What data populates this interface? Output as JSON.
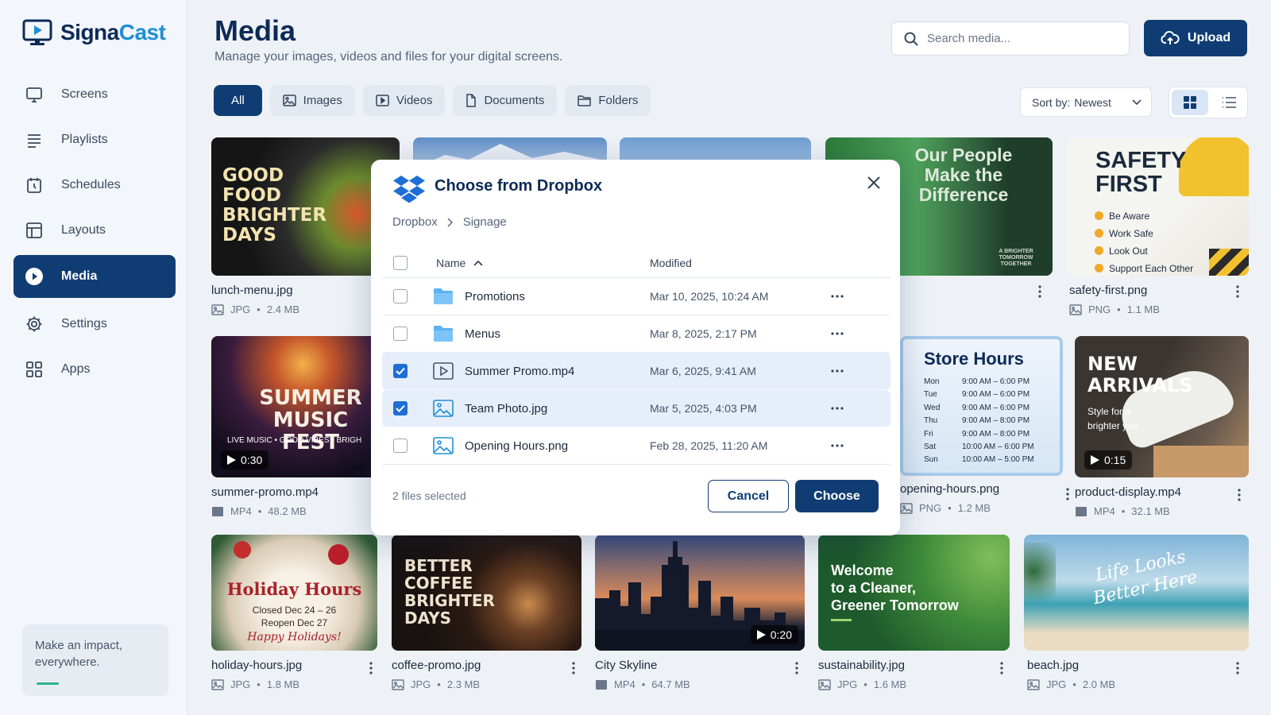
{
  "app": {
    "name_part1": "Signa",
    "name_part2": "Cast"
  },
  "sidebar": {
    "items": [
      {
        "label": "Screens",
        "icon": "monitor-icon"
      },
      {
        "label": "Playlists",
        "icon": "list-icon"
      },
      {
        "label": "Schedules",
        "icon": "calendar-icon"
      },
      {
        "label": "Layouts",
        "icon": "layout-icon"
      },
      {
        "label": "Media",
        "icon": "play-circle-icon",
        "active": true
      },
      {
        "label": "Settings",
        "icon": "gear-icon"
      },
      {
        "label": "Apps",
        "icon": "apps-grid-icon"
      }
    ],
    "tagline": "Make an impact, everywhere."
  },
  "header": {
    "title": "Media",
    "subtitle": "Manage your images, videos and files for your digital screens.",
    "search_placeholder": "Search media...",
    "upload_label": "Upload"
  },
  "filters": {
    "tabs": [
      "All",
      "Images",
      "Videos",
      "Documents",
      "Folders"
    ],
    "active": "All",
    "sort_label": "Sort by:",
    "sort_value": "Newest",
    "view": "grid"
  },
  "cards": [
    {
      "name": "lunch-menu.jpg",
      "type": "JPG",
      "size": "2.4 MB",
      "thumb_lines": [
        "GOOD",
        "FOOD",
        "BRIGHTER",
        "DAYS"
      ]
    },
    {
      "name": "safety-first.png",
      "type": "PNG",
      "size": "1.1 MB",
      "thumb_title": "SAFETY FIRST",
      "thumb_items": [
        "Be Aware",
        "Work Safe",
        "Look Out",
        "Support Each Other"
      ]
    },
    {
      "name": "summer-promo.mp4",
      "type": "MP4",
      "size": "48.2 MB",
      "duration": "0:30",
      "thumb_title": "SUMMER MUSIC FEST",
      "thumb_sub": "LIVE MUSIC • GOOD VIBES • BRIGH"
    },
    {
      "name": "opening-hours.png",
      "type": "PNG",
      "size": "1.2 MB",
      "thumb_title": "Store Hours",
      "hours": [
        [
          "Mon",
          "9:00 AM – 6:00 PM"
        ],
        [
          "Tue",
          "9:00 AM – 6:00 PM"
        ],
        [
          "Wed",
          "9:00 AM – 6:00 PM"
        ],
        [
          "Thu",
          "9:00 AM – 8:00 PM"
        ],
        [
          "Fri",
          "9:00 AM – 8:00 PM"
        ],
        [
          "Sat",
          "10:00 AM – 6:00 PM"
        ],
        [
          "Sun",
          "10:00 AM – 5:00 PM"
        ]
      ]
    },
    {
      "name": "product-display.mp4",
      "type": "MP4",
      "size": "32.1 MB",
      "duration": "0:15",
      "thumb_title": "NEW ARRIVALS",
      "thumb_sub": "Style for a brighter you"
    },
    {
      "name": "holiday-hours.jpg",
      "type": "JPG",
      "size": "1.8 MB",
      "thumb_title": "Holiday Hours",
      "thumb_lines": [
        "Closed Dec 24 – 26",
        "Reopen Dec 27"
      ],
      "thumb_sign": "Happy Holidays!"
    },
    {
      "name": "coffee-promo.jpg",
      "type": "JPG",
      "size": "2.3 MB",
      "thumb_lines": [
        "BETTER",
        "COFFEE",
        "BRIGHTER",
        "DAYS"
      ]
    },
    {
      "name": "City Skyline",
      "type": "MP4",
      "size": "64.7 MB",
      "duration": "0:20"
    },
    {
      "name": "sustainability.jpg",
      "type": "JPG",
      "size": "1.6 MB",
      "thumb_lines": [
        "Welcome",
        "to a Cleaner,",
        "Greener Tomorrow"
      ]
    },
    {
      "name": "beach.jpg",
      "type": "JPG",
      "size": "2.0 MB",
      "thumb_script": "Life Looks Better Here"
    },
    {
      "thumb_title": "Our People Make the Difference",
      "shirt_text": "A BRIGHTER TOMORROW TOGETHER"
    }
  ],
  "modal": {
    "title": "Choose from Dropbox",
    "breadcrumb": [
      "Dropbox",
      "Signage"
    ],
    "columns": {
      "name": "Name",
      "modified": "Modified"
    },
    "rows": [
      {
        "name": "Promotions",
        "kind": "folder",
        "modified": "Mar 10, 2025, 10:24 AM",
        "checked": false
      },
      {
        "name": "Menus",
        "kind": "folder",
        "modified": "Mar 8, 2025, 2:17 PM",
        "checked": false
      },
      {
        "name": "Summer Promo.mp4",
        "kind": "video",
        "modified": "Mar 6, 2025, 9:41 AM",
        "checked": true
      },
      {
        "name": "Team Photo.jpg",
        "kind": "image",
        "modified": "Mar 5, 2025, 4:03 PM",
        "checked": true
      },
      {
        "name": "Opening Hours.png",
        "kind": "image",
        "modified": "Feb 28, 2025, 11:20 AM",
        "checked": false
      }
    ],
    "selected_text": "2 files selected",
    "cancel_label": "Cancel",
    "choose_label": "Choose"
  },
  "colors": {
    "primary": "#0f3d73",
    "accent": "#1f8fd6",
    "checkbox": "#1f6ed4"
  }
}
